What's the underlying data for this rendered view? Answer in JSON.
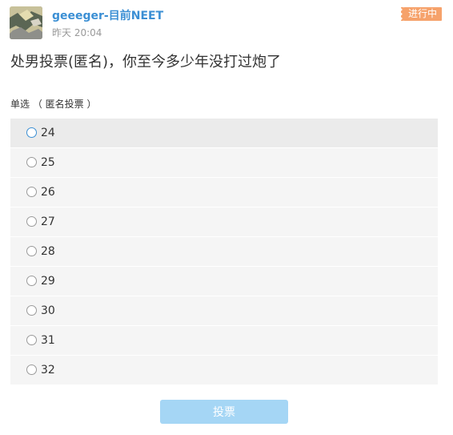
{
  "post": {
    "username": "geeeger-目前NEET",
    "timestamp": "昨天 20:04",
    "status": "进行中"
  },
  "poll": {
    "question": "处男投票(匿名)，你至今多少年没打过炮了",
    "vote_type": "单选 （ 匿名投票 ）",
    "options": [
      {
        "label": "24"
      },
      {
        "label": "25"
      },
      {
        "label": "26"
      },
      {
        "label": "27"
      },
      {
        "label": "28"
      },
      {
        "label": "29"
      },
      {
        "label": "30"
      },
      {
        "label": "31"
      },
      {
        "label": "32"
      }
    ],
    "submit_label": "投票"
  }
}
